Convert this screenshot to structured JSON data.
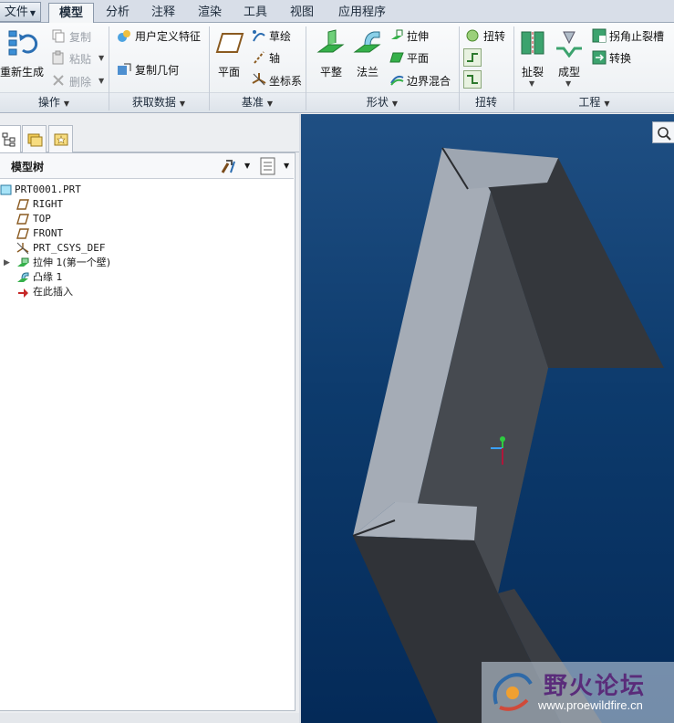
{
  "tabs": {
    "file": "文件",
    "items": [
      "模型",
      "分析",
      "注释",
      "渲染",
      "工具",
      "视图",
      "应用程序"
    ],
    "active": "模型"
  },
  "ribbon": {
    "operations": {
      "regenerate": "重新生成",
      "copy": "复制",
      "paste": "粘贴",
      "delete": "删除",
      "label": "操作"
    },
    "get_data": {
      "udf": "用户定义特征",
      "copy_geometry": "复制几何",
      "label": "获取数据"
    },
    "datum": {
      "plane": "平面",
      "sketch": "草绘",
      "axis": "轴",
      "csys": "坐标系",
      "label": "基准"
    },
    "shapes": {
      "flat": "平整",
      "flange": "法兰",
      "extrude": "拉伸",
      "planar": "平面",
      "boundary_blend": "边界混合",
      "label": "形状"
    },
    "twist": {
      "twist": "扭转",
      "label": "扭转"
    },
    "engineering": {
      "rip": "扯裂",
      "form": "成型",
      "corner_relief": "拐角止裂槽",
      "convert": "转换",
      "label": "工程"
    }
  },
  "model_tree": {
    "title": "模型树",
    "items": [
      {
        "label": "PRT0001.PRT",
        "icon": "part-icon"
      },
      {
        "label": "RIGHT",
        "icon": "datum-plane-icon"
      },
      {
        "label": "TOP",
        "icon": "datum-plane-icon"
      },
      {
        "label": "FRONT",
        "icon": "datum-plane-icon"
      },
      {
        "label": "PRT_CSYS_DEF",
        "icon": "csys-icon"
      },
      {
        "label": "拉伸 1(第一个壁)",
        "icon": "extrude-wall-icon"
      },
      {
        "label": "凸缘 1",
        "icon": "flange-icon"
      },
      {
        "label": "在此插入",
        "icon": "insert-here-arrow-icon"
      }
    ]
  },
  "watermark": {
    "title": "野火论坛",
    "url": "www.proewildfire.cn"
  },
  "colors": {
    "viewport_top": "#1f4f83",
    "viewport_bottom": "#042a58",
    "part_light": "#a8b0bb",
    "part_dark": "#3a3d43"
  }
}
